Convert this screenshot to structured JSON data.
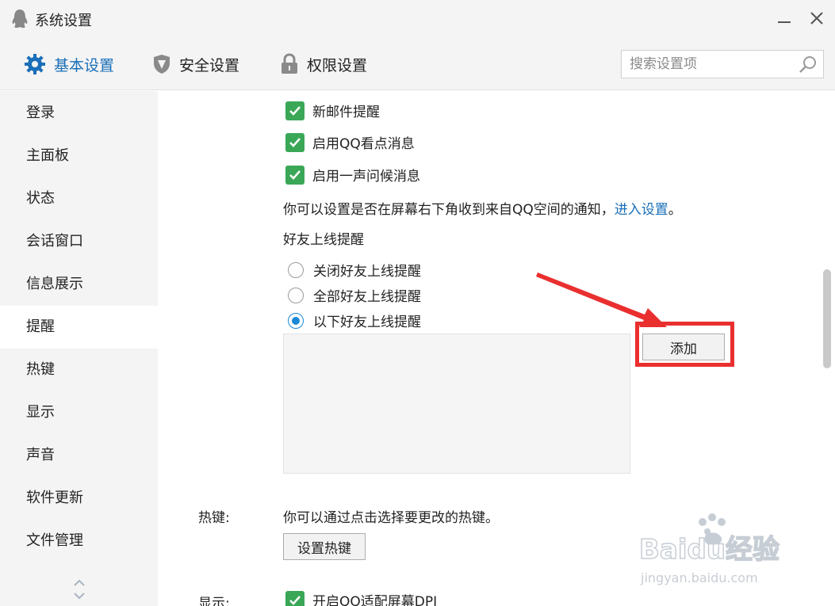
{
  "window": {
    "title": "系统设置"
  },
  "tabs": [
    {
      "label": "基本设置",
      "icon": "gear-icon"
    },
    {
      "label": "安全设置",
      "icon": "shield-icon"
    },
    {
      "label": "权限设置",
      "icon": "lock-icon"
    }
  ],
  "search": {
    "placeholder": "搜索设置项",
    "value": ""
  },
  "sidebar": {
    "items": [
      {
        "label": "登录"
      },
      {
        "label": "主面板"
      },
      {
        "label": "状态"
      },
      {
        "label": "会话窗口"
      },
      {
        "label": "信息展示"
      },
      {
        "label": "提醒",
        "active": true
      },
      {
        "label": "热键"
      },
      {
        "label": "显示"
      },
      {
        "label": "声音"
      },
      {
        "label": "软件更新"
      },
      {
        "label": "文件管理"
      }
    ]
  },
  "notifications": {
    "checkboxes": [
      {
        "label": "新邮件提醒",
        "checked": true
      },
      {
        "label": "启用QQ看点消息",
        "checked": true
      },
      {
        "label": "启用一声问候消息",
        "checked": true
      }
    ],
    "qzone_text": "你可以设置是否在屏幕右下角收到来自QQ空间的通知，",
    "qzone_link": "进入设置",
    "qzone_end": "。",
    "friend_online_title": "好友上线提醒",
    "radios": [
      {
        "label": "关闭好友上线提醒",
        "checked": false
      },
      {
        "label": "全部好友上线提醒",
        "checked": false
      },
      {
        "label": "以下好友上线提醒",
        "checked": true
      }
    ],
    "add_button": "添加"
  },
  "hotkey": {
    "label": "热键:",
    "description": "你可以通过点击选择要更改的热键。",
    "button": "设置热键"
  },
  "display": {
    "label": "显示:",
    "checkbox_label": "开启QQ适配屏幕DPI"
  },
  "colors": {
    "accent": "#1a6fb8",
    "check_green": "#3aa757",
    "annotation_red": "#ea2f2f"
  },
  "watermark": {
    "brand": "Baidu经验",
    "url": "jingyan.baidu.com"
  }
}
